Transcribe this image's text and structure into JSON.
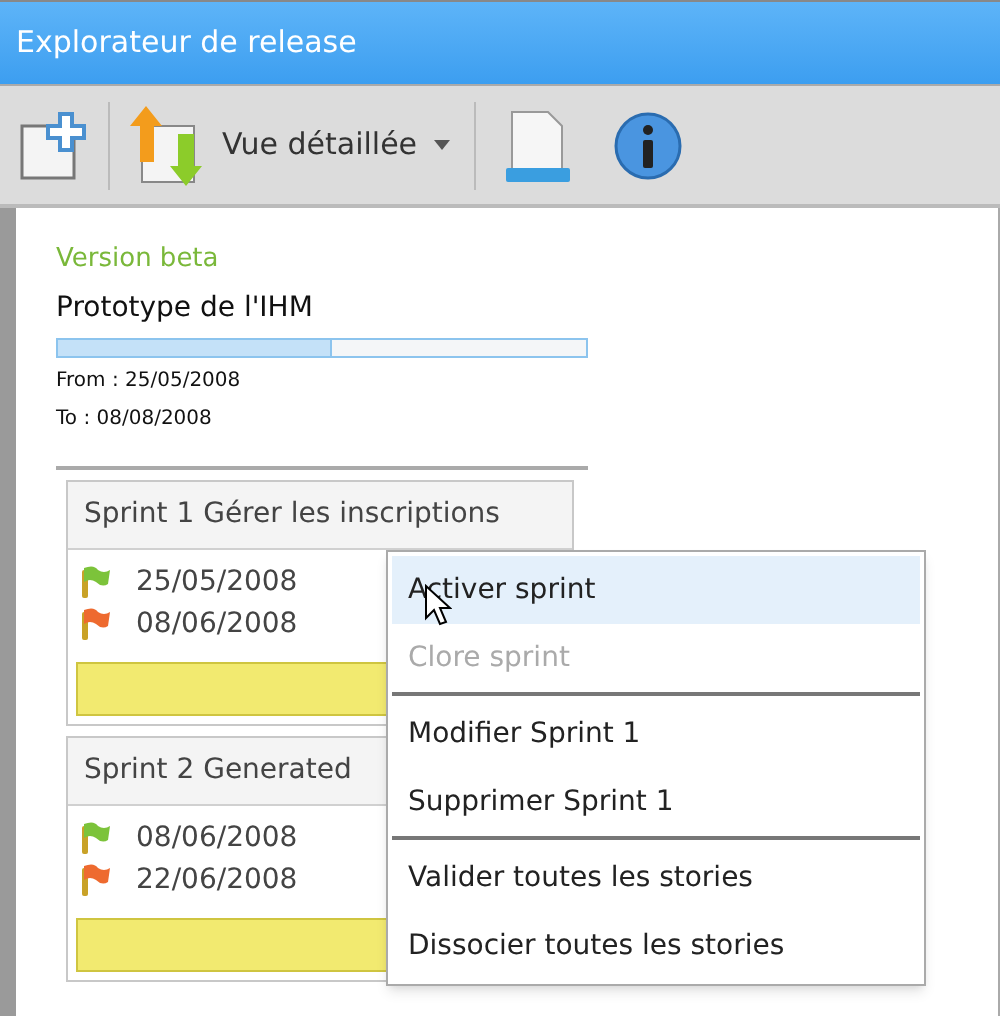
{
  "window": {
    "title": "Explorateur de release"
  },
  "toolbar": {
    "view_menu": {
      "label": "Vue détaillée"
    }
  },
  "release": {
    "version": "Version beta",
    "name": "Prototype de l'IHM",
    "progress": {
      "level": 0.52
    },
    "from": "From : 25/05/2008",
    "to": "To : 08/08/2008"
  },
  "sprints": [
    {
      "title": "Sprint 1 Gérer les inscriptions",
      "start": "25/05/2008",
      "end": "08/06/2008"
    },
    {
      "title": "Sprint 2 Generated",
      "start": "08/06/2008",
      "end": "22/06/2008"
    }
  ],
  "context_menu": {
    "groups": [
      [
        {
          "label": "Activer sprint",
          "selected": true,
          "disabled": false
        },
        {
          "label": "Clore sprint",
          "selected": false,
          "disabled": true
        }
      ],
      [
        {
          "label": "Modifier Sprint 1",
          "selected": false,
          "disabled": false
        },
        {
          "label": "Supprimer Sprint 1",
          "selected": false,
          "disabled": false
        }
      ],
      [
        {
          "label": "Valider toutes les stories",
          "selected": false,
          "disabled": false
        },
        {
          "label": "Dissocier toutes les stories",
          "selected": false,
          "disabled": false
        }
      ]
    ]
  }
}
